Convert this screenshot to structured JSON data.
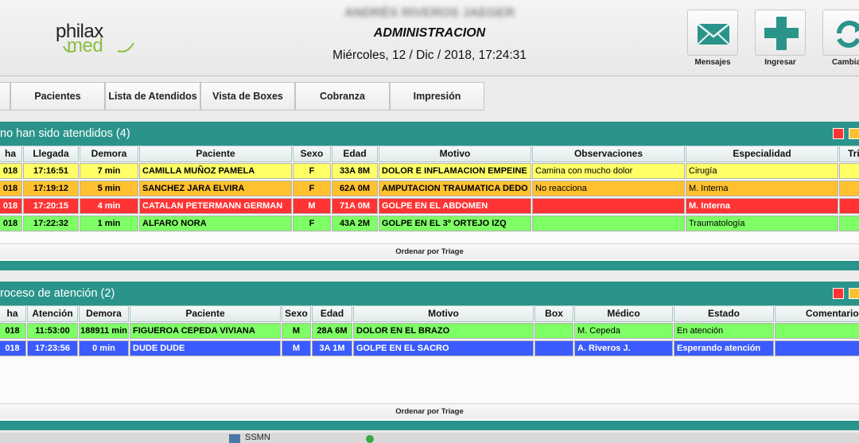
{
  "header": {
    "logo_top": "philax",
    "logo_bottom": "med",
    "user_name": "ANDRÉS RIVEROS JAEGER",
    "role": "ADMINISTRACION",
    "date": "Miércoles, 12 / Dic / 2018, 17:24:31",
    "buttons": [
      {
        "label": "Mensajes",
        "icon": "envelope-icon"
      },
      {
        "label": "Ingresar",
        "icon": "plus-icon"
      },
      {
        "label": "Cambiar",
        "icon": "refresh-icon"
      }
    ]
  },
  "nav": {
    "tabs": [
      "Pacientes",
      "Lista de Atendidos",
      "Vista de Boxes",
      "Cobranza",
      "Impresión"
    ]
  },
  "colors": {
    "teal": "#2a948a",
    "yellow": "#ffff66",
    "orange": "#ffc12f",
    "red": "#ff3333",
    "green": "#7fff66",
    "blue": "#3b5bff"
  },
  "waiting": {
    "title": "no han sido atendidos (4)",
    "columns": [
      "ha",
      "Llegada",
      "Demora",
      "Paciente",
      "Sexo",
      "Edad",
      "Motivo",
      "Observaciones",
      "Especialidad",
      "Tri"
    ],
    "rows": [
      {
        "fecha": "018",
        "llegada": "17:16:51",
        "demora": "7 min",
        "paciente": "CAMILLA MUÑOZ PAMELA",
        "sexo": "F",
        "edad": "33A 8M",
        "motivo": "DOLOR E INFLAMACION EMPEINE",
        "observaciones": "Camina con mucho dolor",
        "especialidad": "Cirugía",
        "color": "yellow"
      },
      {
        "fecha": "018",
        "llegada": "17:19:12",
        "demora": "5 min",
        "paciente": "SANCHEZ JARA ELVIRA",
        "sexo": "F",
        "edad": "62A 0M",
        "motivo": "AMPUTACION TRAUMATICA DEDO",
        "observaciones": "No reacciona",
        "especialidad": "M. Interna",
        "color": "orange"
      },
      {
        "fecha": "018",
        "llegada": "17:20:15",
        "demora": "4 min",
        "paciente": "CATALAN PETERMANN GERMAN",
        "sexo": "M",
        "edad": "71A 0M",
        "motivo": "GOLPE EN EL ABDOMEN",
        "observaciones": "",
        "especialidad": "M. Interna",
        "color": "red"
      },
      {
        "fecha": "018",
        "llegada": "17:22:32",
        "demora": "1 min",
        "paciente": "ALFARO NORA",
        "sexo": "F",
        "edad": "43A 2M",
        "motivo": "GOLPE EN EL 3º ORTEJO IZQ",
        "observaciones": "",
        "especialidad": "Traumatología",
        "color": "green"
      }
    ],
    "sort_label": "Ordenar por Triage"
  },
  "in_progress": {
    "title": "roceso de atención (2)",
    "columns": [
      "ha",
      "Atención",
      "Demora",
      "Paciente",
      "Sexo",
      "Edad",
      "Motivo",
      "Box",
      "Médico",
      "Estado",
      "Comentarios"
    ],
    "rows": [
      {
        "fecha": "018",
        "atencion": "11:53:00",
        "demora": "188911 min",
        "paciente": "FIGUEROA CEPEDA VIVIANA",
        "sexo": "M",
        "edad": "28A 6M",
        "motivo": "DOLOR EN EL BRAZO",
        "box": "",
        "medico": "M. Cepeda",
        "estado": "En atención",
        "comentarios": "",
        "color": "green"
      },
      {
        "fecha": "018",
        "atencion": "17:23:56",
        "demora": "0 min",
        "paciente": "DUDE DUDE",
        "sexo": "M",
        "edad": "3A 1M",
        "motivo": "GOLPE EN EL SACRO",
        "box": "",
        "medico": "A. Riveros J.",
        "estado": "Esperando atención",
        "comentarios": "",
        "color": "blue"
      }
    ],
    "sort_label": "Ordenar por Triage"
  },
  "bottom_peek": "SSMN"
}
